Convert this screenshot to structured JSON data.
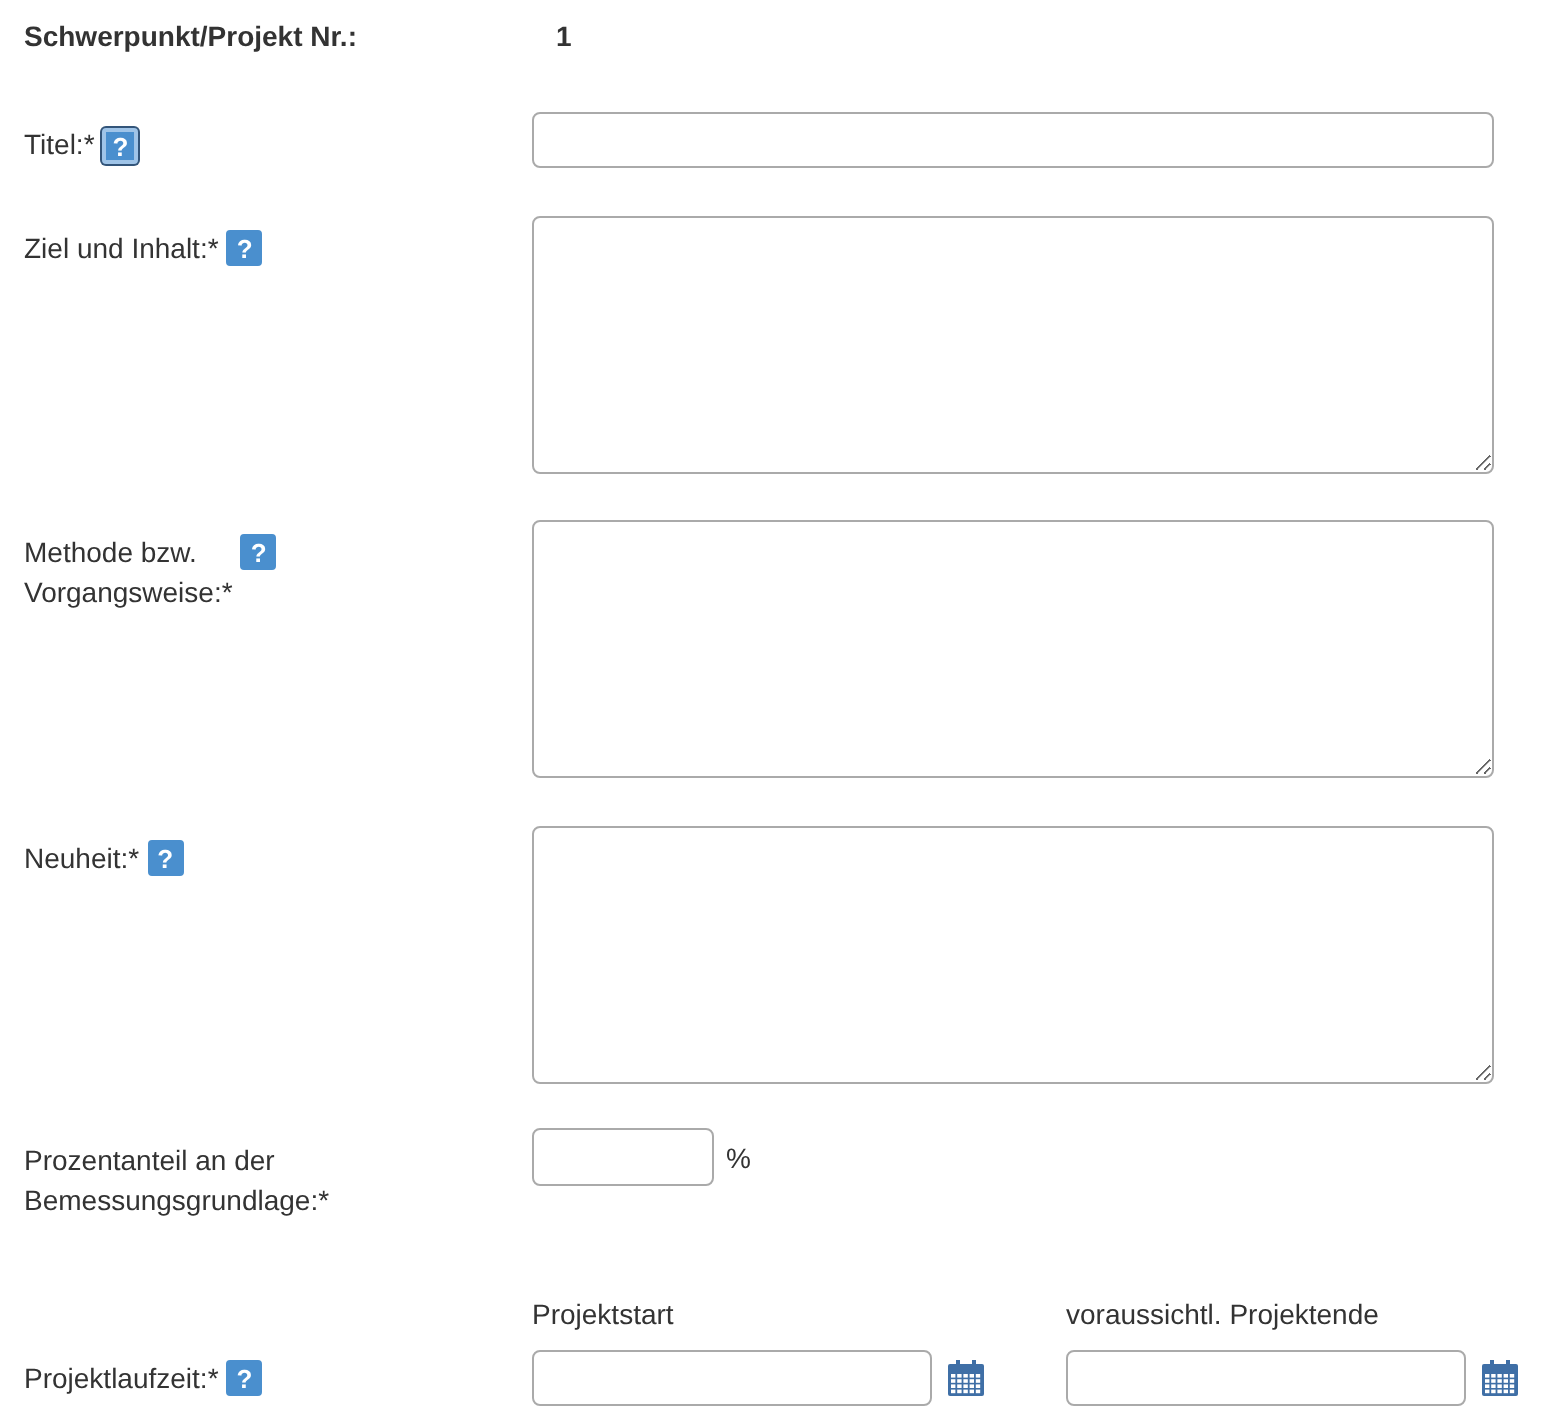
{
  "header": {
    "label": "Schwerpunkt/Projekt Nr.:",
    "value": "1"
  },
  "fields": [
    {
      "kind": "text",
      "label": [
        "Titel:*"
      ],
      "help": "?",
      "help_focused": true
    },
    {
      "kind": "textarea",
      "label": [
        "Ziel und Inhalt:*"
      ],
      "help": "?",
      "help_focused": false
    },
    {
      "kind": "textarea",
      "label": [
        "Methode bzw.",
        "Vorgangsweise:*"
      ],
      "help": "?",
      "help_focused": false
    },
    {
      "kind": "textarea",
      "label": [
        "Neuheit:*"
      ],
      "help": "?",
      "help_focused": false
    },
    {
      "kind": "percent",
      "label": [
        "Prozentanteil an der",
        "Bemessungsgrundlage:*"
      ],
      "unit": "%"
    },
    {
      "kind": "daterange",
      "label": [
        "Projektlaufzeit:*"
      ],
      "help": "?",
      "help_focused": false,
      "dates": [
        {
          "caption": "Projektstart"
        },
        {
          "caption": "voraussichtl. Projektende"
        }
      ]
    }
  ]
}
